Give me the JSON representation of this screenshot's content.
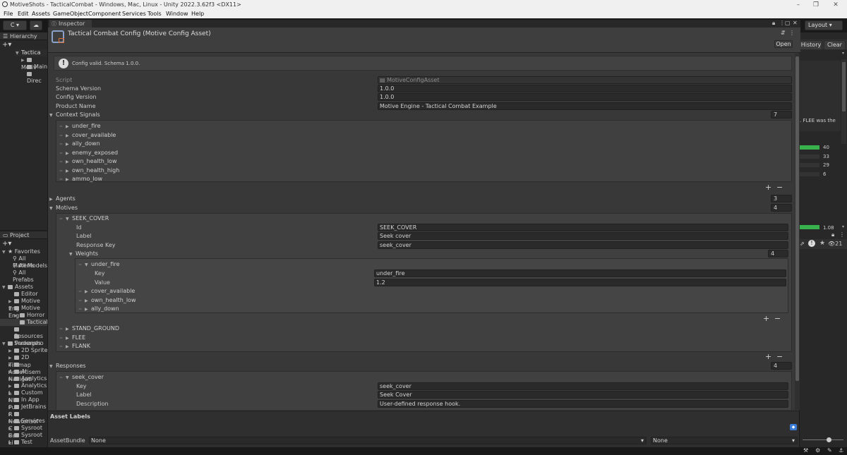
{
  "window_title": "MotiveShots - TacticalCombat - Windows, Mac, Linux - Unity 2022.3.62f3 <DX11>",
  "menu": [
    "File",
    "Edit",
    "Assets",
    "GameObject",
    "Component",
    "Services",
    "Tools",
    "Window",
    "Help"
  ],
  "toolbar": {
    "account_label": "C ▾",
    "layout_label": "Layout"
  },
  "hierarchy": {
    "tab": "Hierarchy",
    "items": [
      "Tactica",
      "Motiv",
      "Main",
      "Direc"
    ]
  },
  "project": {
    "tab": "Project",
    "favorites_label": "Favorites",
    "favorites": [
      "All Materia",
      "All Models",
      "All Prefabs"
    ],
    "assets_label": "Assets",
    "assets": [
      "Editor",
      "Motive Eng",
      "Motive Eng",
      "Horror N",
      "Tactical",
      "Resources",
      "Screensho"
    ],
    "packages_label": "Packages",
    "packages": [
      "2D Sprite",
      "2D Tilemap",
      "Advertisem",
      "AI Navigati",
      "Analytics",
      "Analytics L",
      "Custom NU",
      "In App Pur",
      "JetBrains R",
      "Newtonsof",
      "Services C",
      "Sysroot Ba",
      "Sysroot Li",
      "Test Framework"
    ]
  },
  "inspector": {
    "tab": "Inspector",
    "asset_title": "Tactical Combat Config (Motive Config Asset)",
    "open_button": "Open",
    "message": "Config valid. Schema 1.0.0.",
    "script_label": "Script",
    "script_value": "MotiveConfigAsset",
    "schema_version_label": "Schema Version",
    "schema_version": "1.0.0",
    "config_version_label": "Config Version",
    "config_version": "1.0.0",
    "product_name_label": "Product Name",
    "product_name": "Motive Engine - Tactical Combat Example",
    "context_signals_label": "Context Signals",
    "context_signals_count": "7",
    "context_signals": [
      "under_fire",
      "cover_available",
      "ally_down",
      "enemy_exposed",
      "own_health_low",
      "own_health_high",
      "ammo_low"
    ],
    "agents_label": "Agents",
    "agents_count": "3",
    "motives_label": "Motives",
    "motives_count": "4",
    "motive0": {
      "name": "SEEK_COVER",
      "id_label": "Id",
      "id": "SEEK_COVER",
      "label_label": "Label",
      "label": "Seek cover",
      "response_key_label": "Response Key",
      "response_key": "seek_cover",
      "weights_label": "Weights",
      "weights_count": "4",
      "weight0": {
        "name": "under_fire",
        "key_label": "Key",
        "key": "under_fire",
        "value_label": "Value",
        "value": "1.2"
      },
      "other_weights": [
        "cover_available",
        "own_health_low",
        "ally_down"
      ]
    },
    "other_motives": [
      "STAND_GROUND",
      "FLEE",
      "FLANK"
    ],
    "responses_label": "Responses",
    "responses_count": "4",
    "response0": {
      "name": "seek_cover",
      "key_label": "Key",
      "key": "seek_cover",
      "label_label": "Label",
      "label": "Seek Cover",
      "description_label": "Description",
      "description": "User-defined response hook."
    },
    "asset_labels": "Asset Labels",
    "assetbundle_label": "AssetBundle",
    "assetbundle_value": "None",
    "assetbundle_variant": "None"
  },
  "right_panel": {
    "history": "History",
    "clear": "Clear",
    "log_text": ". FLEE was the",
    "bars": [
      {
        "value": "40",
        "fill": 1.0
      },
      {
        "value": "33",
        "fill": 0.0
      },
      {
        "value": "29",
        "fill": 0.0
      },
      {
        "value": "6",
        "fill": 0.0
      }
    ],
    "bottom_bar_value": "1.08",
    "count_badge": "21"
  },
  "colors": {
    "accent_green": "#37b24d",
    "selection": "#2c5d87"
  }
}
